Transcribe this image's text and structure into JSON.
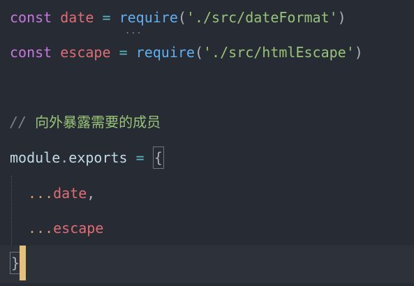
{
  "editor": {
    "line1": {
      "keyword": "const",
      "name": "date",
      "op": "=",
      "fn": "require",
      "open": "(",
      "string": "'./src/dateFormat'",
      "close": ")"
    },
    "line2": {
      "keyword": "const",
      "name": "escape",
      "op": "=",
      "fn": "require",
      "open": "(",
      "string": "'./src/htmlEscape'",
      "close": ")"
    },
    "comment_slashes": "//",
    "comment_text": "向外暴露需要的成员",
    "line5": {
      "module": "module",
      "dot": ".",
      "exports": "exports",
      "op": "=",
      "brace_open": "{"
    },
    "line6": {
      "spread": "...",
      "name": "date",
      "comma": ","
    },
    "line7": {
      "spread": "...",
      "name": "escape"
    },
    "line8": {
      "brace_close": "}"
    },
    "hint_dots": "..."
  }
}
